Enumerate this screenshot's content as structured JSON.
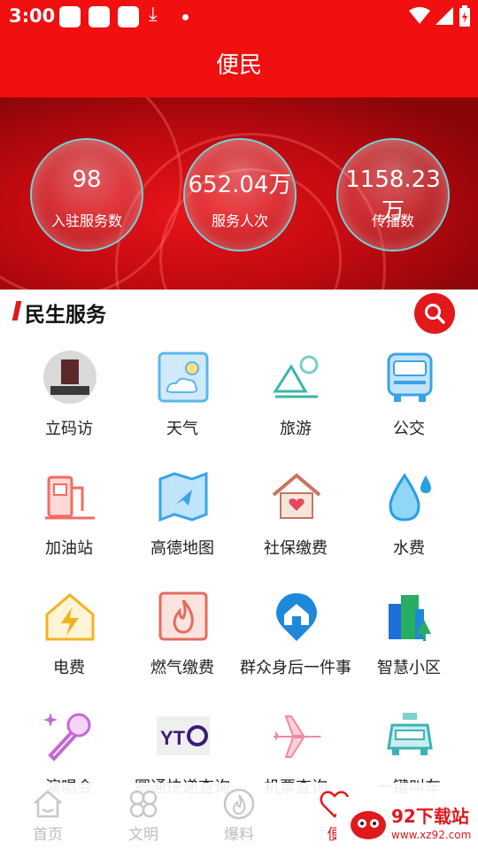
{
  "status_bar": {
    "time": "3:00"
  },
  "header": {
    "title": "便民"
  },
  "stats": [
    {
      "value": "98",
      "label": "入驻服务数"
    },
    {
      "value": "652.04万",
      "label": "服务人次"
    },
    {
      "value": "1158.23万",
      "label": "传播数"
    }
  ],
  "section": {
    "title": "民生服务"
  },
  "services": [
    {
      "label": "立码访"
    },
    {
      "label": "天气"
    },
    {
      "label": "旅游"
    },
    {
      "label": "公交"
    },
    {
      "label": "加油站"
    },
    {
      "label": "高德地图"
    },
    {
      "label": "社保缴费"
    },
    {
      "label": "水费"
    },
    {
      "label": "电费"
    },
    {
      "label": "燃气缴费"
    },
    {
      "label": "群众身后一件事"
    },
    {
      "label": "智慧小区"
    },
    {
      "label": "演唱会"
    },
    {
      "label": "圆通快递查询"
    },
    {
      "label": "机票查询"
    },
    {
      "label": "一键叫车"
    }
  ],
  "tabs": [
    {
      "label": "首页"
    },
    {
      "label": "文明"
    },
    {
      "label": "爆料"
    },
    {
      "label": "便"
    }
  ],
  "watermark": {
    "site": "92下载站",
    "url": "www.xz92.com"
  },
  "colors": {
    "brand_red": "#f01010",
    "accent_red": "#e0191d",
    "bubble_border": "#6fd3d6"
  }
}
